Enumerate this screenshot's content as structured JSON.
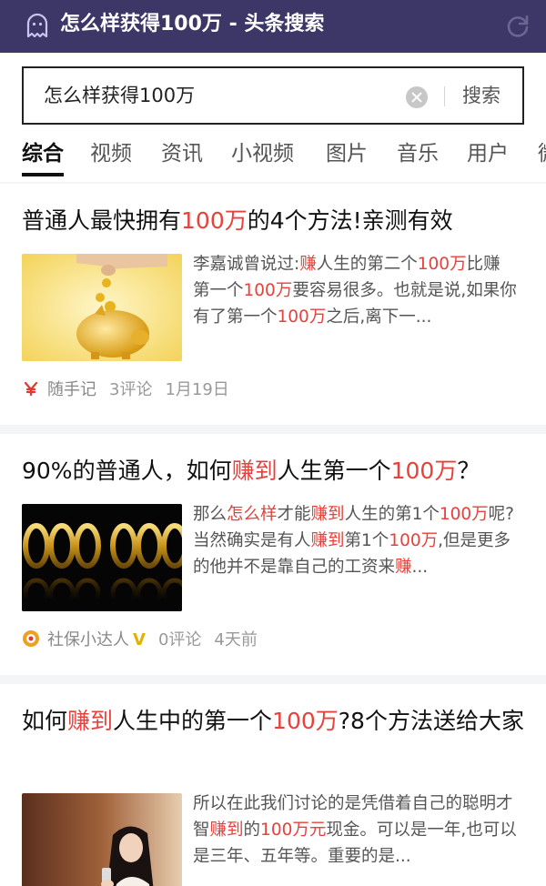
{
  "app": {
    "title": "怎么样获得100万 - 头条搜索",
    "icons": {
      "logo": "ghost-icon",
      "refresh": "refresh-icon"
    },
    "colors": {
      "titlebar": "#3d3767",
      "highlight": "#e8413c"
    }
  },
  "search": {
    "query": "怎么样获得100万",
    "button_label": "搜索"
  },
  "tabs": [
    {
      "label": "综合",
      "active": true
    },
    {
      "label": "视频"
    },
    {
      "label": "资讯"
    },
    {
      "label": "小视频"
    },
    {
      "label": "图片"
    },
    {
      "label": "音乐"
    },
    {
      "label": "用户"
    },
    {
      "label": "微"
    }
  ],
  "results": [
    {
      "title": [
        "普通人最快拥有",
        "100万",
        "的4个方法!亲测有效"
      ],
      "snippet": [
        "李嘉诚曾说过:",
        "赚",
        "人生的第二个",
        "100万",
        "比赚第一个",
        "100万",
        "要容易很多。也就是说,如果你有了第一个",
        "100万",
        "之后,离下一..."
      ],
      "source": "随手记",
      "comments": "3评论",
      "time": "1月19日",
      "thumb": "piggy-bank-coins-image"
    },
    {
      "title": [
        "90%的普通人，如何",
        "赚到",
        "人生第一个",
        "100万",
        "？"
      ],
      "snippet": [
        "那么",
        "怎么样",
        "才能",
        "赚到",
        "人生的第1个",
        "100万",
        "呢?当然确实是有人",
        "赚到",
        "第1个",
        "100万",
        ",但是更多的他并不是靠自己的工资来",
        "赚",
        "..."
      ],
      "source": "社保小达人",
      "verified": "V",
      "comments": "0评论",
      "time": "4天前",
      "thumb": "gold-zeros-image"
    },
    {
      "title": [
        "如何",
        "赚到",
        "人生中的第一个",
        "100万",
        "?8个方法送给大家"
      ],
      "snippet": [
        "所以在此我们讨论的是凭借着自己的聪明才智",
        "赚到",
        "的",
        "100万元",
        "现金。可以是一年,也可以是三年、五年等。重要的是..."
      ],
      "thumb": "woman-portrait-image"
    }
  ]
}
